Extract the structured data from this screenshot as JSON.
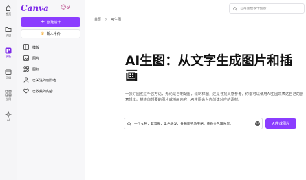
{
  "rail": {
    "items": [
      {
        "label": "首页",
        "icon": "home-icon"
      },
      {
        "label": "项目",
        "icon": "folder-icon"
      },
      {
        "label": "模板",
        "icon": "template-icon"
      },
      {
        "label": "品牌",
        "icon": "brand-icon"
      },
      {
        "label": "应用",
        "icon": "apps-icon"
      },
      {
        "label": "AI",
        "icon": "sparkle-icon"
      }
    ],
    "active_index": 2
  },
  "sidebar": {
    "logo": "Canva",
    "create_label": "创建设计",
    "trial_label": "新人半价",
    "items": [
      {
        "label": "模板",
        "icon": "template-icon"
      },
      {
        "label": "图片",
        "icon": "image-icon"
      },
      {
        "label": "图标",
        "icon": "shapes-icon"
      },
      {
        "label": "已关注的创作者",
        "icon": "creators-icon"
      },
      {
        "label": "已收藏的内容",
        "icon": "heart-icon"
      }
    ]
  },
  "search": {
    "placeholder": "在海量模板中搜索"
  },
  "breadcrumb": {
    "home": "首页",
    "separator": ">",
    "current": "AI生图"
  },
  "hero": {
    "title": "AI生图：从文字生成图片和插画",
    "description": "一张好图胜过千言万语，无论是自制配图，绘制样图，还是寻找灵感参考，你都可以使用AI生图来表达自己的创意想法。描述你想要的图片或插画内容，AI生图会为你创建对应的素材。"
  },
  "prompt": {
    "value": "一位女神，茸茸雅，柔色头发，骨骼面子马甲裙，黄昏金色阳光里。",
    "button_label": "AI生成图片"
  },
  "colors": {
    "accent": "#8b3dff",
    "logo": "#7d2ae8"
  }
}
